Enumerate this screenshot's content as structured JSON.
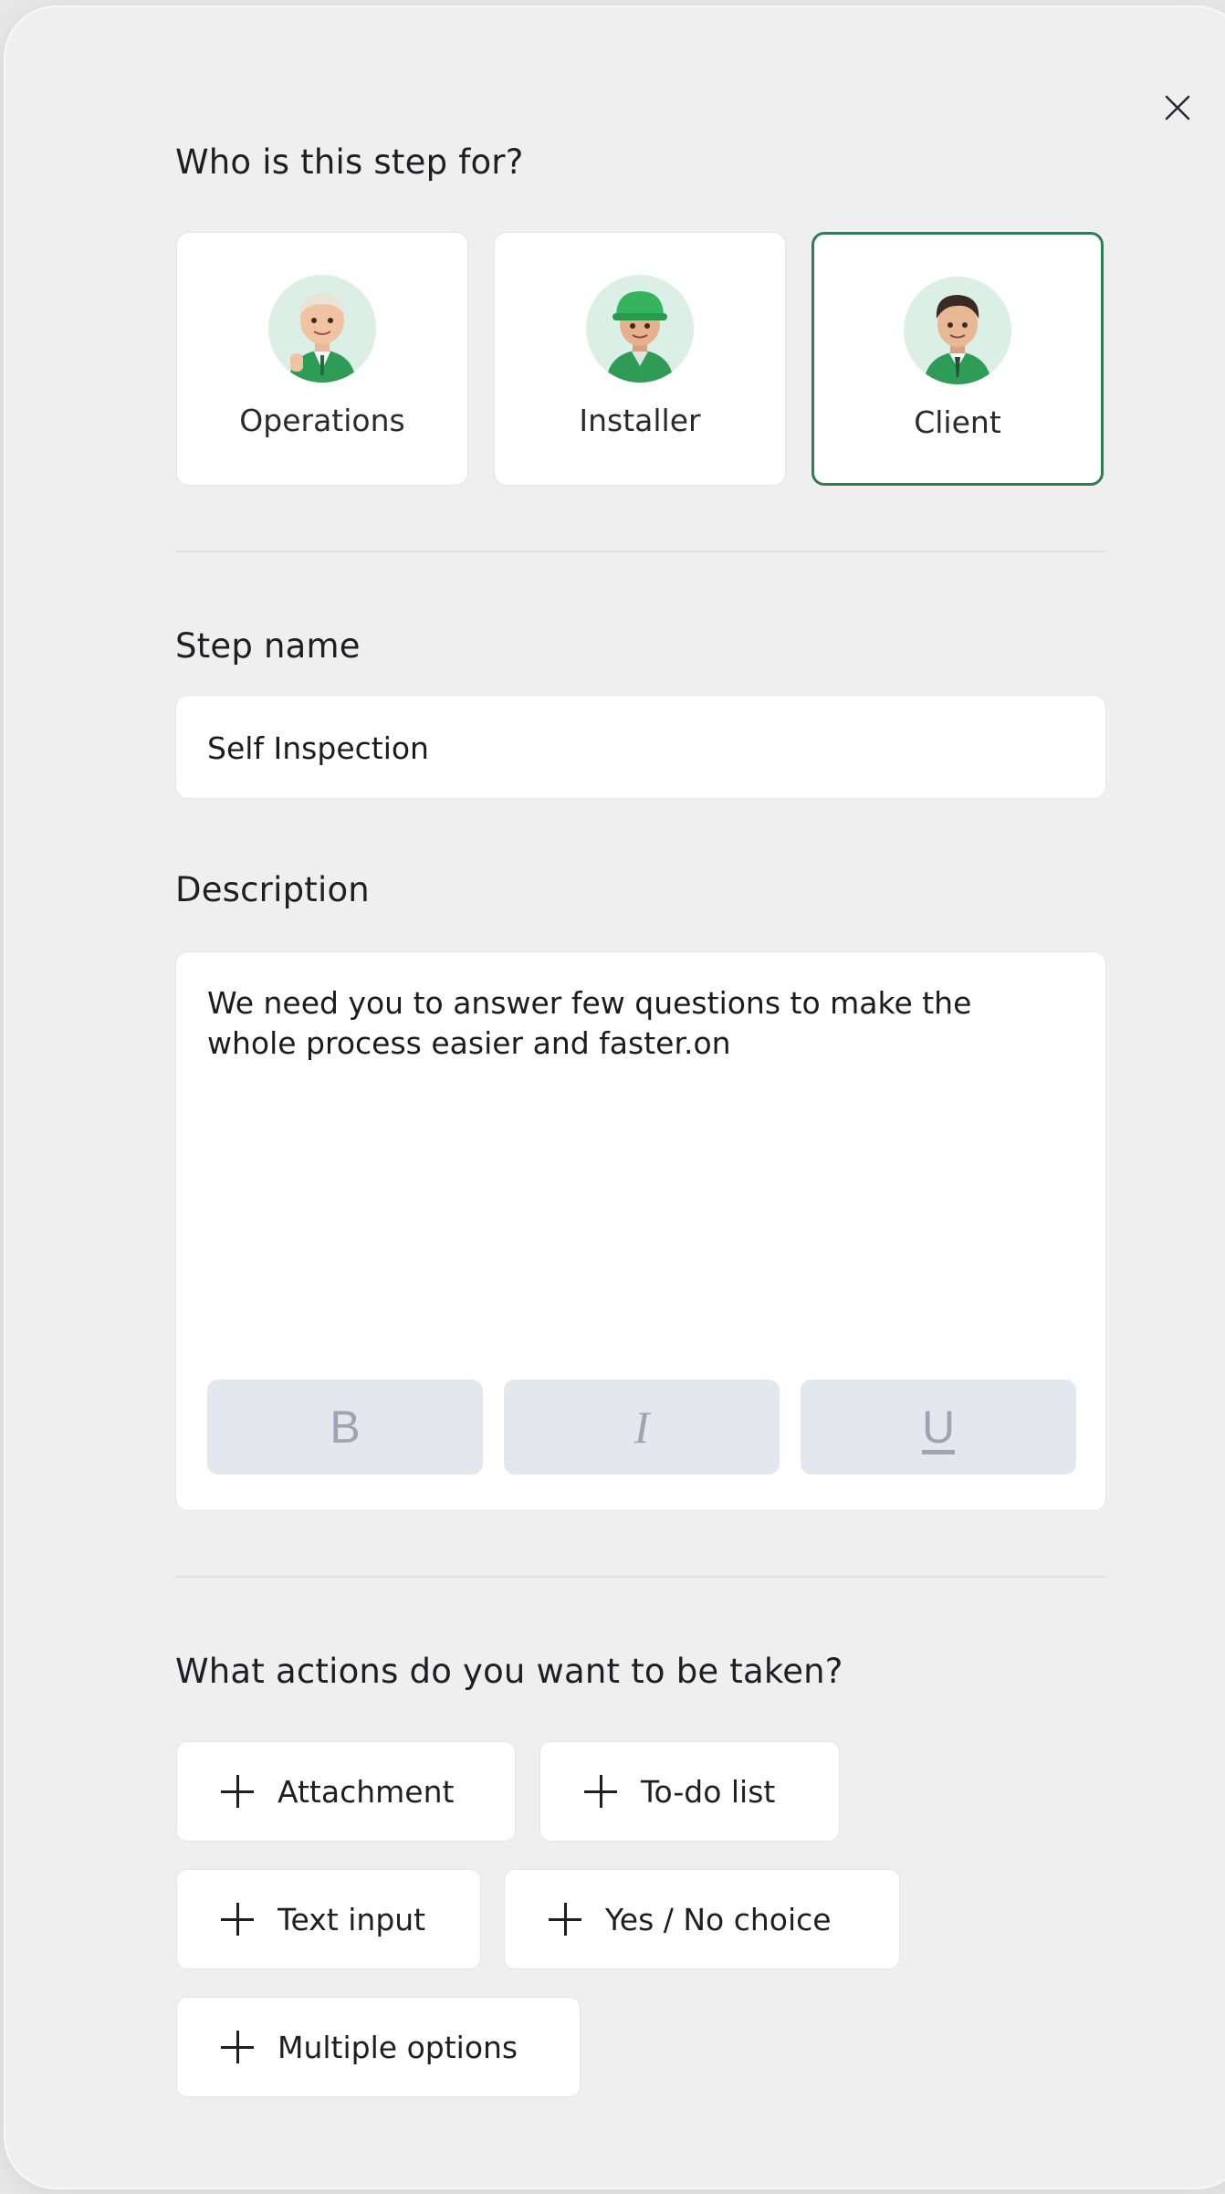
{
  "dialog": {
    "close_icon": "close-icon",
    "audience": {
      "heading": "Who is this step for?",
      "options": [
        {
          "label": "Operations",
          "icon": "operations-avatar",
          "selected": false
        },
        {
          "label": "Installer",
          "icon": "installer-avatar",
          "selected": false
        },
        {
          "label": "Client",
          "icon": "client-avatar",
          "selected": true
        }
      ]
    },
    "step_name": {
      "label": "Step name",
      "value": "Self Inspection"
    },
    "description": {
      "label": "Description",
      "value": "We need you to answer few questions to make the whole process easier and faster.on",
      "toolbar": {
        "bold": "B",
        "italic": "I",
        "underline": "U"
      }
    },
    "actions": {
      "heading": "What actions do you want to be taken?",
      "items": [
        "Attachment",
        "To-do list",
        "Text input",
        "Yes / No choice",
        "Multiple options"
      ]
    }
  },
  "colors": {
    "accent": "#2f7d52",
    "avatar_bg": "#dcefe6",
    "format_button_bg": "#e3e7ee"
  }
}
